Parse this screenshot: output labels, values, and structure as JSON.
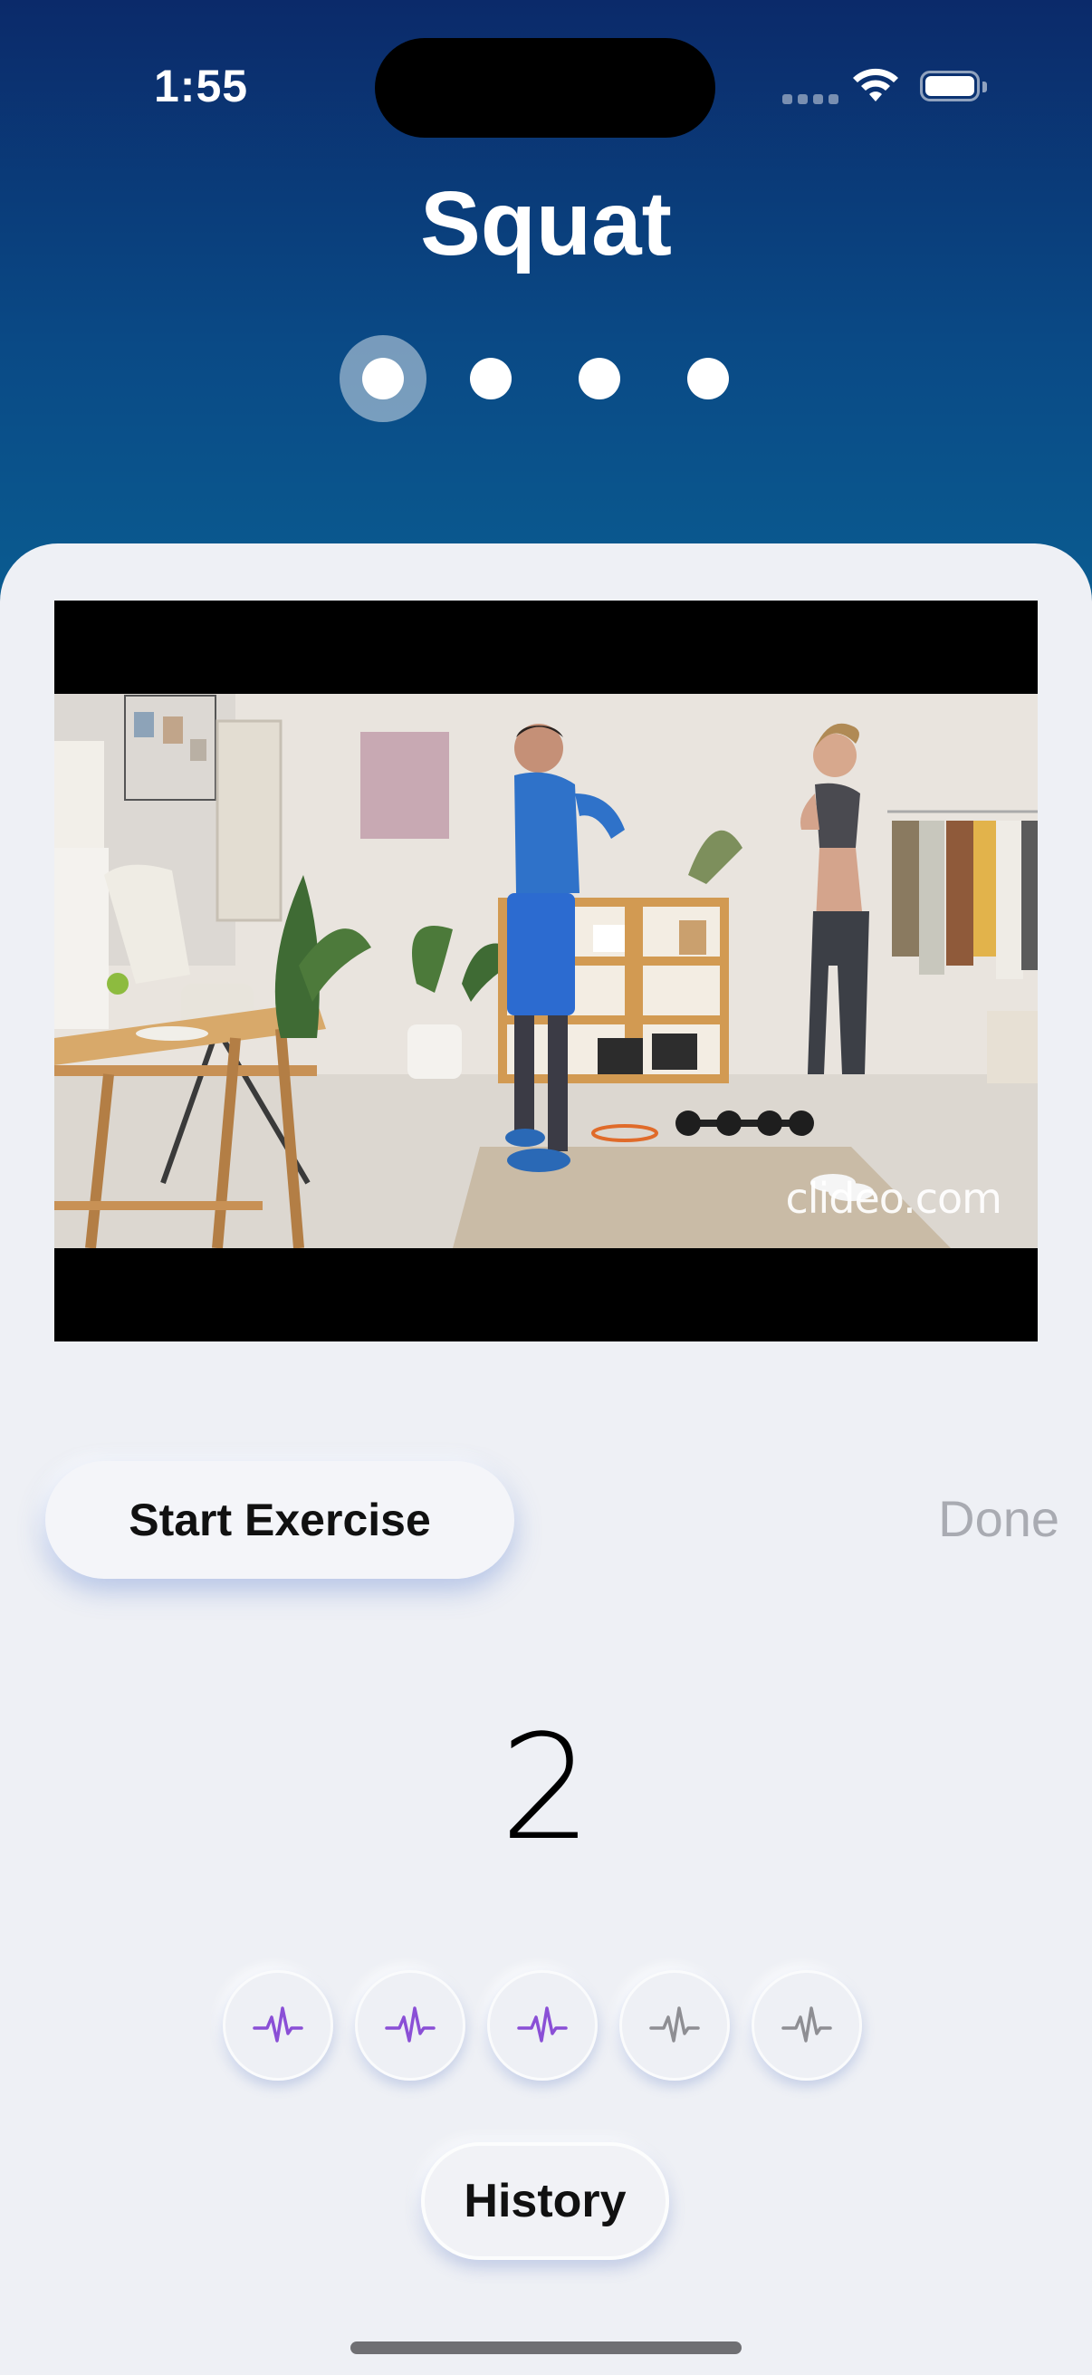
{
  "status_bar": {
    "time": "1:55",
    "wifi_icon": "wifi-icon",
    "battery_icon": "battery-icon"
  },
  "header": {
    "title": "Squat",
    "page_indicator": {
      "count": 4,
      "active_index": 0
    }
  },
  "video": {
    "watermark": "clideo.com"
  },
  "controls": {
    "start_label": "Start Exercise",
    "done_label": "Done"
  },
  "rep_count": "2",
  "history_icons": [
    {
      "icon": "heartbeat-icon",
      "active": true,
      "color": "#8a4fd6"
    },
    {
      "icon": "heartbeat-icon",
      "active": true,
      "color": "#8a4fd6"
    },
    {
      "icon": "heartbeat-icon",
      "active": true,
      "color": "#8a4fd6"
    },
    {
      "icon": "heartbeat-icon",
      "active": false,
      "color": "#8e8e93"
    },
    {
      "icon": "heartbeat-icon",
      "active": false,
      "color": "#8e8e93"
    }
  ],
  "history_label": "History",
  "colors": {
    "header_top": "#0b2a6a",
    "header_bottom": "#0a5e92",
    "accent_purple": "#8a4fd6",
    "done_disabled": "#a9abb2"
  }
}
